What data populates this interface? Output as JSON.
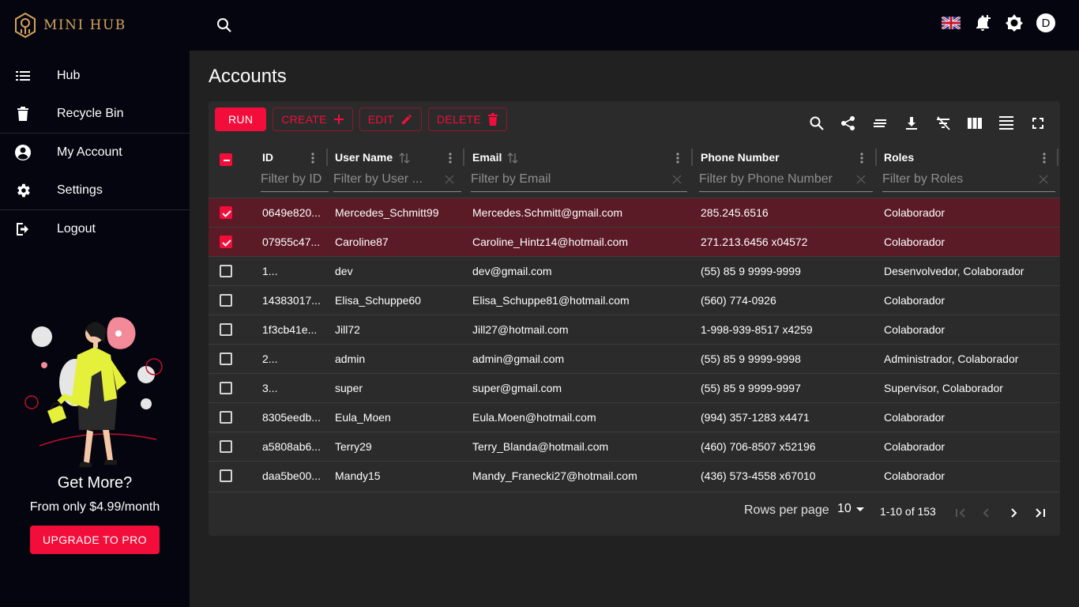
{
  "app": {
    "brand": "MINI HUB",
    "avatar_letter": "D"
  },
  "sidebar": {
    "items": [
      {
        "label": "Hub",
        "icon": "list-icon"
      },
      {
        "label": "Recycle Bin",
        "icon": "trash-icon"
      },
      {
        "label": "My Account",
        "icon": "account-circle-icon"
      },
      {
        "label": "Settings",
        "icon": "gear-icon"
      },
      {
        "label": "Logout",
        "icon": "logout-icon"
      }
    ],
    "promo": {
      "title": "Get More?",
      "subtitle": "From only $4.99/month",
      "button": "UPGRADE TO PRO"
    }
  },
  "page": {
    "title": "Accounts"
  },
  "toolbar": {
    "run": "RUN",
    "create": "CREATE",
    "edit": "EDIT",
    "delete": "DELETE"
  },
  "table": {
    "columns": [
      {
        "title": "ID",
        "filter_placeholder": "Filter by ID"
      },
      {
        "title": "User Name",
        "filter_placeholder": "Filter by User ..."
      },
      {
        "title": "Email",
        "filter_placeholder": "Filter by Email"
      },
      {
        "title": "Phone Number",
        "filter_placeholder": "Filter by Phone Number"
      },
      {
        "title": "Roles",
        "filter_placeholder": "Filter by Roles"
      }
    ],
    "rows": [
      {
        "selected": true,
        "id": "0649e820...",
        "user": "Mercedes_Schmitt99",
        "email": "Mercedes.Schmitt@gmail.com",
        "phone": "285.245.6516",
        "roles": "Colaborador"
      },
      {
        "selected": true,
        "id": "07955c47...",
        "user": "Caroline87",
        "email": "Caroline_Hintz14@hotmail.com",
        "phone": "271.213.6456 x04572",
        "roles": "Colaborador"
      },
      {
        "selected": false,
        "id": "1...",
        "user": "dev",
        "email": "dev@gmail.com",
        "phone": "(55) 85 9 9999-9999",
        "roles": "Desenvolvedor, Colaborador"
      },
      {
        "selected": false,
        "id": "14383017...",
        "user": "Elisa_Schuppe60",
        "email": "Elisa_Schuppe81@hotmail.com",
        "phone": "(560) 774-0926",
        "roles": "Colaborador"
      },
      {
        "selected": false,
        "id": "1f3cb41e...",
        "user": "Jill72",
        "email": "Jill27@hotmail.com",
        "phone": "1-998-939-8517 x4259",
        "roles": "Colaborador"
      },
      {
        "selected": false,
        "id": "2...",
        "user": "admin",
        "email": "admin@gmail.com",
        "phone": "(55) 85 9 9999-9998",
        "roles": "Administrador, Colaborador"
      },
      {
        "selected": false,
        "id": "3...",
        "user": "super",
        "email": "super@gmail.com",
        "phone": "(55) 85 9 9999-9997",
        "roles": "Supervisor, Colaborador"
      },
      {
        "selected": false,
        "id": "8305eedb...",
        "user": "Eula_Moen",
        "email": "Eula.Moen@hotmail.com",
        "phone": "(994) 357-1283 x4471",
        "roles": "Colaborador"
      },
      {
        "selected": false,
        "id": "a5808ab6...",
        "user": "Terry29",
        "email": "Terry_Blanda@hotmail.com",
        "phone": "(460) 706-8507 x52196",
        "roles": "Colaborador"
      },
      {
        "selected": false,
        "id": "daa5be00...",
        "user": "Mandy15",
        "email": "Mandy_Franecki27@hotmail.com",
        "phone": "(436) 573-4558 x67010",
        "roles": "Colaborador"
      }
    ]
  },
  "pagination": {
    "rows_per_page_label": "Rows per page",
    "rows_per_page": "10",
    "range": "1-10 of 153"
  },
  "colors": {
    "accent": "#f30d3a",
    "selected_row": "#5a1a26",
    "brand_gold": "#d4a25a"
  }
}
